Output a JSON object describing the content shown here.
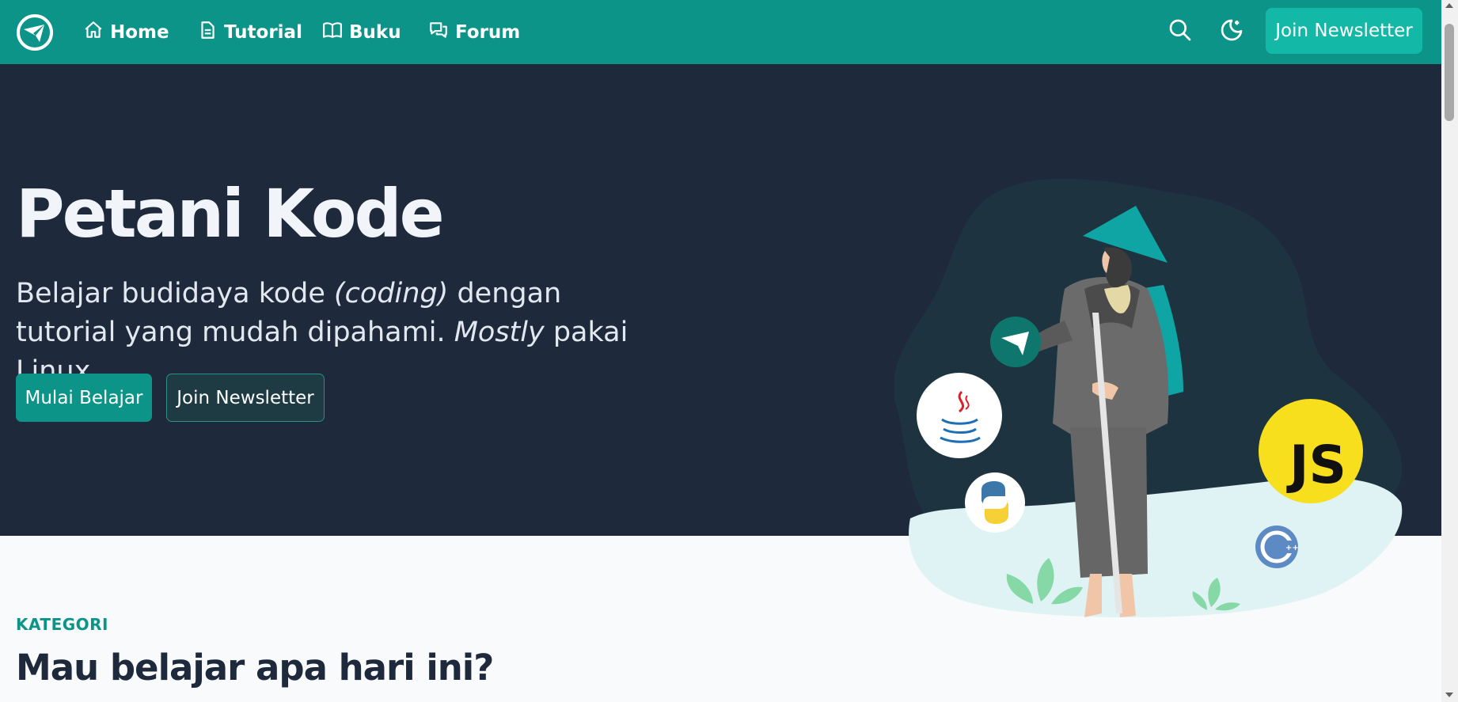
{
  "navbar": {
    "logo_icon": "petani-kode-logo-icon",
    "items": [
      {
        "label": "Home",
        "icon": "home-icon"
      },
      {
        "label": "Tutorial",
        "icon": "document-icon"
      },
      {
        "label": "Buku",
        "icon": "book-icon"
      },
      {
        "label": "Forum",
        "icon": "chat-icon"
      }
    ],
    "search_icon": "search-icon",
    "theme_icon": "moon-icon",
    "cta_label": "Join Newsletter",
    "color": "#0d9488"
  },
  "hero": {
    "title": "Petani Kode",
    "subtitle_part1": "Belajar budidaya kode ",
    "subtitle_em1": "(coding)",
    "subtitle_part2": " dengan tutorial yang mudah dipahami. ",
    "subtitle_em2": "Mostly",
    "subtitle_part3": " pakai Linux.",
    "primary_button": "Mulai Belajar",
    "secondary_button": "Join Newsletter",
    "background": "#1e293b",
    "illustration_labels": {
      "js_badge": "JS"
    }
  },
  "category": {
    "label": "KATEGORI",
    "title": "Mau belajar apa hari ini?"
  }
}
